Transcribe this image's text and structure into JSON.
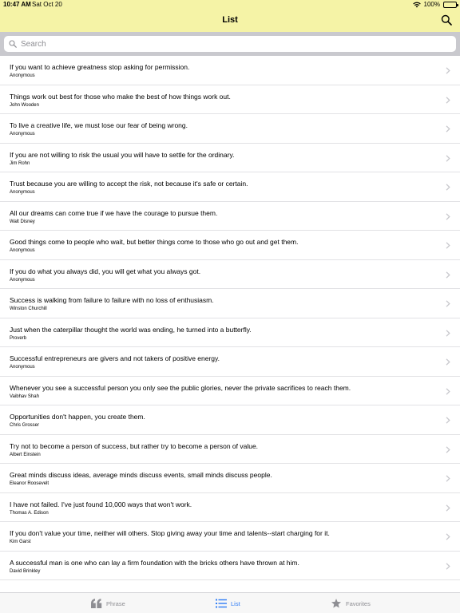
{
  "status_bar": {
    "time": "10:47 AM",
    "date": "Sat Oct 20",
    "battery": "100%"
  },
  "nav": {
    "title": "List"
  },
  "search": {
    "placeholder": "Search"
  },
  "quotes": [
    {
      "text": "If you want to achieve greatness stop asking for permission.",
      "author": "Anonymous"
    },
    {
      "text": "Things work out best for those who make the best of how things work out.",
      "author": "John Wooden"
    },
    {
      "text": "To live a creative life, we must lose our fear of being wrong.",
      "author": "Anonymous"
    },
    {
      "text": "If you are not willing to risk the usual you will have to settle for the ordinary.",
      "author": "Jim Rohn"
    },
    {
      "text": "Trust because you are willing to accept the risk, not because it's safe or certain.",
      "author": "Anonymous"
    },
    {
      "text": "All our dreams can come true if we have the courage to pursue them.",
      "author": "Walt Disney"
    },
    {
      "text": "Good things come to people who wait, but better things come to those who go out and get them.",
      "author": "Anonymous"
    },
    {
      "text": "If you do what you always did, you will get what you always got.",
      "author": "Anonymous"
    },
    {
      "text": "Success is walking from failure to failure with no loss of enthusiasm.",
      "author": "Winston Churchill"
    },
    {
      "text": "Just when the caterpillar thought the world was ending, he turned into a butterfly.",
      "author": "Proverb"
    },
    {
      "text": "Successful entrepreneurs are givers and not takers of positive energy.",
      "author": "Anonymous"
    },
    {
      "text": "Whenever you see a successful person you only see the public glories, never the private sacrifices to reach them.",
      "author": "Vaibhav Shah"
    },
    {
      "text": "Opportunities don't happen, you create them.",
      "author": "Chris Grosser"
    },
    {
      "text": "Try not to become a person of success, but rather try to become a person of value.",
      "author": "Albert Einstein"
    },
    {
      "text": "Great minds discuss ideas, average minds discuss events, small minds discuss people.",
      "author": "Eleanor Roosevelt"
    },
    {
      "text": "I have not failed. I've just found 10,000 ways that won't work.",
      "author": "Thomas A. Edison"
    },
    {
      "text": "If you don't value your time, neither will others. Stop giving away your time and talents--start charging for it.",
      "author": "Kim Garst"
    },
    {
      "text": "A successful man is one who can lay a firm foundation with the bricks others have thrown at him.",
      "author": "David Brinkley"
    }
  ],
  "tabs": {
    "phrase": "Phrase",
    "list": "List",
    "favorites": "Favorites"
  },
  "colors": {
    "header_bg": "#f5f3a6",
    "active_tab": "#2f7cf6",
    "inactive_tab": "#8e8e93"
  }
}
